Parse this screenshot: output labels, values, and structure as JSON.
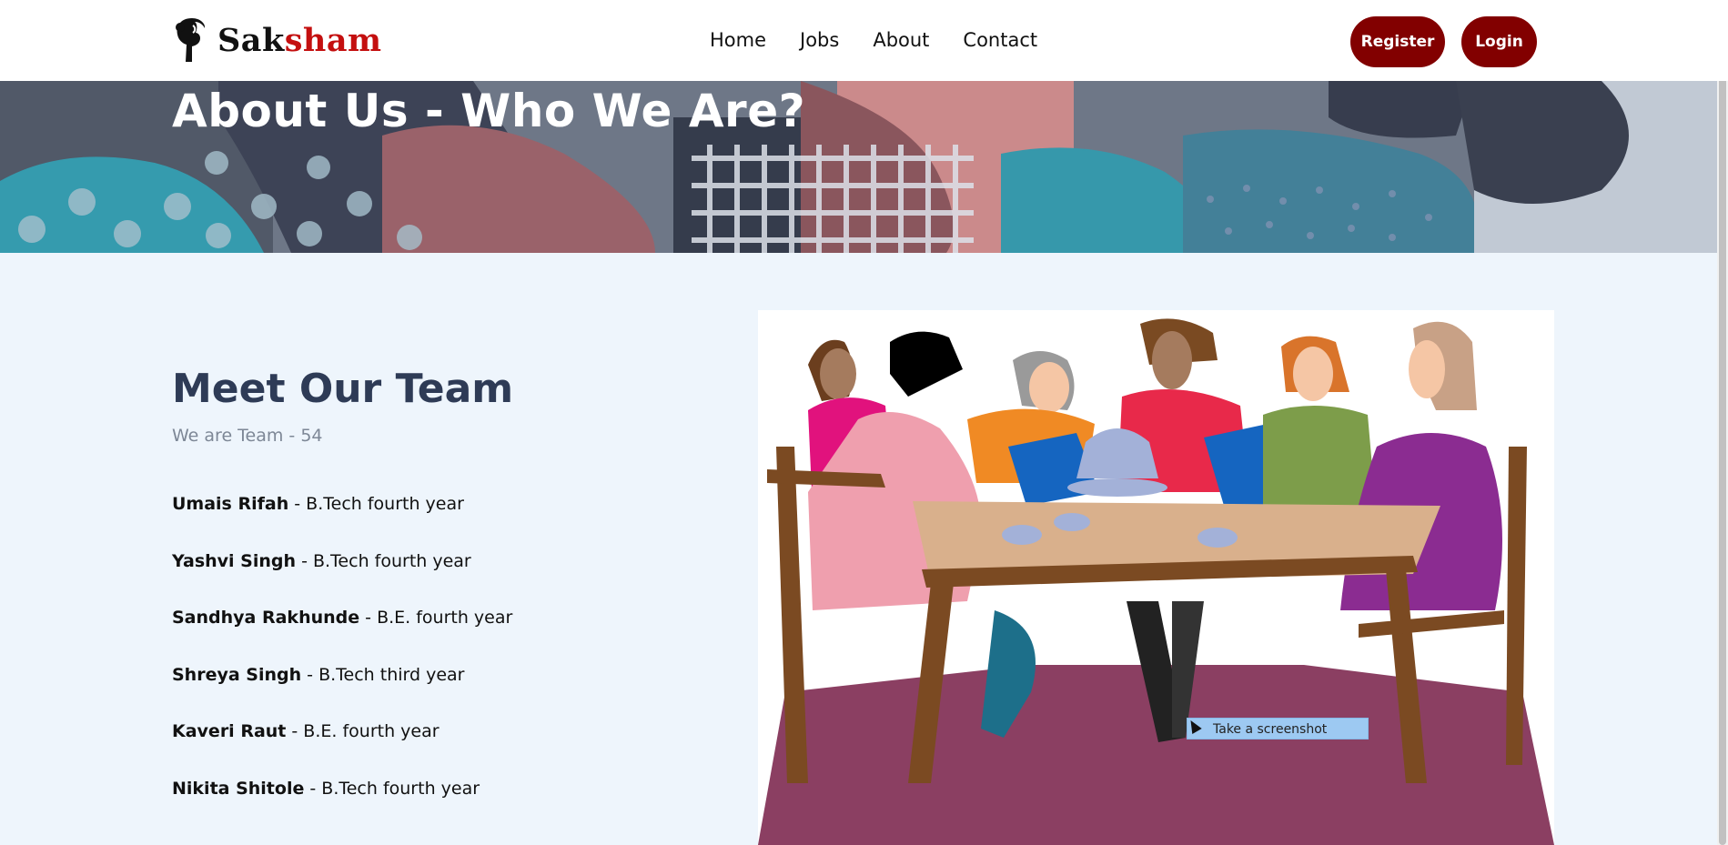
{
  "brand": {
    "part1": "Sak",
    "part2": "sham",
    "accent": "#c40f0f"
  },
  "nav": {
    "links": [
      "Home",
      "Jobs",
      "About",
      "Contact"
    ],
    "register": "Register",
    "login": "Login",
    "button_color": "#820000"
  },
  "hero": {
    "title": "About Us - Who We Are?"
  },
  "team": {
    "heading": "Meet Our Team",
    "subtitle": "We are Team - 54",
    "members": [
      {
        "name": "Umais Rifah",
        "detail": " - B.Tech fourth year"
      },
      {
        "name": "Yashvi Singh",
        "detail": " - B.Tech fourth year"
      },
      {
        "name": "Sandhya Rakhunde",
        "detail": " - B.E. fourth year"
      },
      {
        "name": "Shreya Singh",
        "detail": " - B.Tech third year"
      },
      {
        "name": "Kaveri Raut",
        "detail": " - B.E. fourth year"
      },
      {
        "name": "Nikita Shitole",
        "detail": " - B.Tech fourth year"
      }
    ]
  },
  "tooltip": {
    "text": "Take a screenshot"
  }
}
